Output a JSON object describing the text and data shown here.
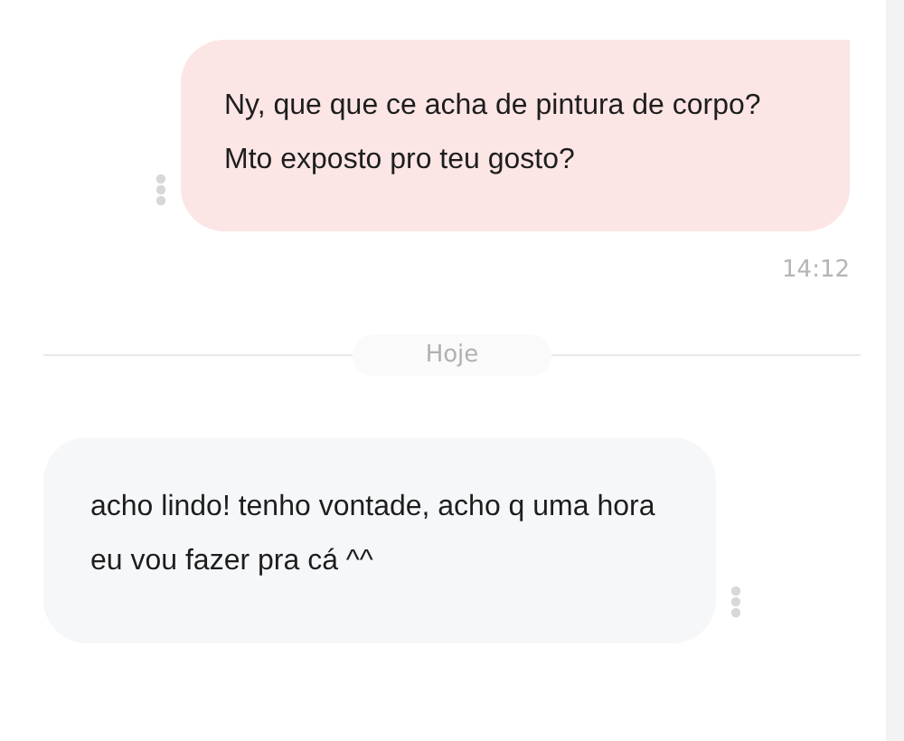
{
  "messages": [
    {
      "kind": "outgoing",
      "text": "Ny, que que ce acha de pintura de corpo? Mto exposto pro teu gosto?",
      "time": "14:12"
    },
    {
      "kind": "divider",
      "text": "Hoje"
    },
    {
      "kind": "incoming",
      "text": "acho lindo! tenho vontade, acho q uma hora eu vou fazer pra cá ^^"
    }
  ]
}
